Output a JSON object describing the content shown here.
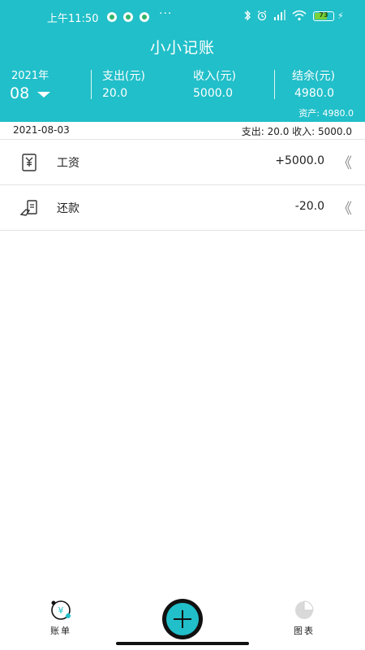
{
  "status_bar": {
    "time": "上午11:50",
    "more": "···",
    "battery_level": "73",
    "battery_fraction": 0.73,
    "icons": [
      "shield-icon",
      "shield-icon",
      "shield-icon",
      "bluetooth-icon",
      "alarm-icon",
      "signal-icon",
      "wifi-icon",
      "battery-icon",
      "charging-icon"
    ]
  },
  "app": {
    "title": "小小记账"
  },
  "summary": {
    "year": "2021年",
    "month": "08",
    "expense_label": "支出(元)",
    "expense_value": "20.0",
    "income_label": "收入(元)",
    "income_value": "5000.0",
    "balance_label": "结余(元)",
    "balance_value": "4980.0",
    "assets": "资产: 4980.0"
  },
  "day": {
    "date": "2021-08-03",
    "summary": "支出: 20.0 收入: 5000.0"
  },
  "entries": [
    {
      "label": "工资",
      "amount": "+5000.0",
      "icon": "salary-icon"
    },
    {
      "label": "还款",
      "amount": "-20.0",
      "icon": "repayment-icon"
    }
  ],
  "tabbar": {
    "bills_label": "账单",
    "charts_label": "图表"
  },
  "colors": {
    "accent": "#21bfc9",
    "text": "#222222",
    "divider": "#e4e4e4",
    "battery": "#7bd13a"
  }
}
